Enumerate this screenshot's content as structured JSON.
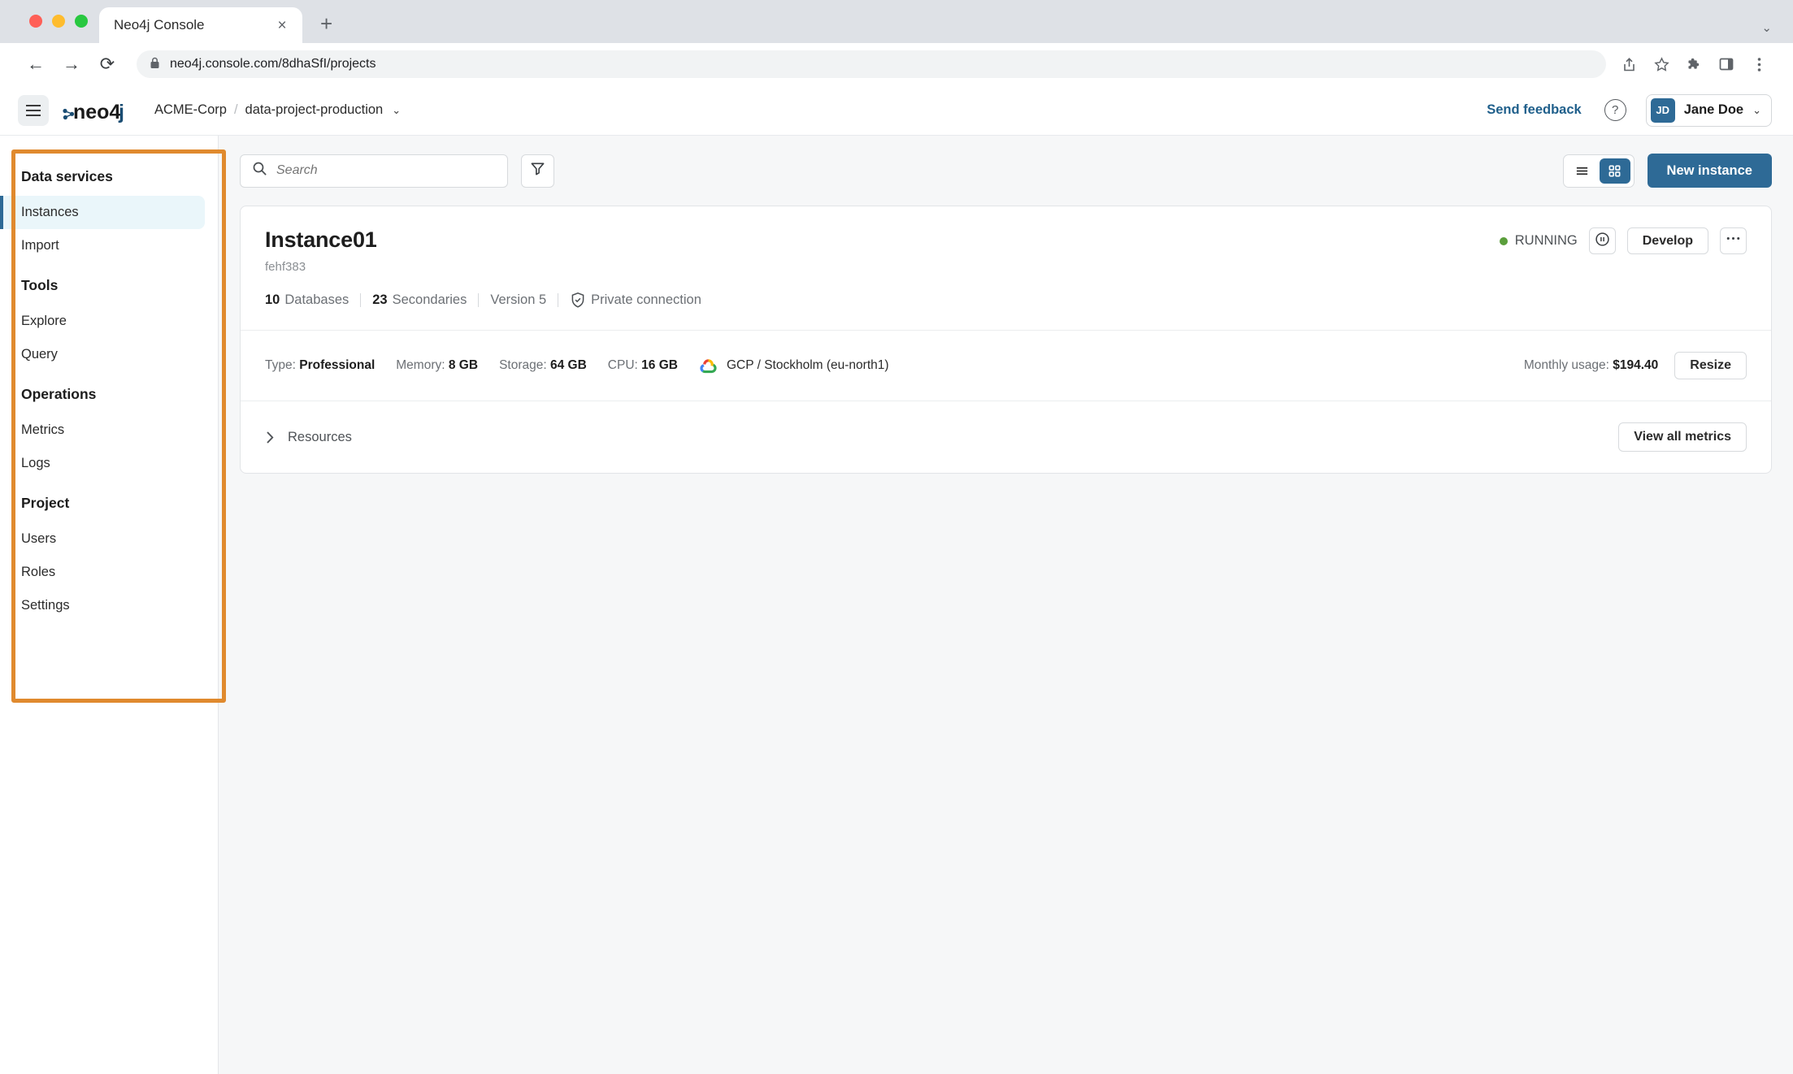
{
  "browser": {
    "tab_title": "Neo4j Console",
    "close_label": "×",
    "newtab_label": "+",
    "back_label": "←",
    "forward_label": "→",
    "reload_label": "⟳",
    "url": "neo4j.console.com/8dhaSfI/projects",
    "lock_icon": "lock-icon",
    "window_chevron": "⌄"
  },
  "appbar": {
    "menu_icon": "hamburger-icon",
    "logo_text": "neo4j",
    "breadcrumb": {
      "org": "ACME-Corp",
      "separator": "/",
      "project": "data-project-production",
      "caret": "⌄"
    },
    "send_feedback": "Send feedback",
    "help_label": "?",
    "user": {
      "initials": "JD",
      "name": "Jane Doe",
      "caret": "⌄"
    }
  },
  "sidebar": {
    "sections": [
      {
        "title": "Data services",
        "items": [
          {
            "label": "Instances",
            "active": true
          },
          {
            "label": "Import",
            "active": false
          }
        ]
      },
      {
        "title": "Tools",
        "items": [
          {
            "label": "Explore",
            "active": false
          },
          {
            "label": "Query",
            "active": false
          }
        ]
      },
      {
        "title": "Operations",
        "items": [
          {
            "label": "Metrics",
            "active": false
          },
          {
            "label": "Logs",
            "active": false
          }
        ]
      },
      {
        "title": "Project",
        "items": [
          {
            "label": "Users",
            "active": false
          },
          {
            "label": "Roles",
            "active": false
          },
          {
            "label": "Settings",
            "active": false
          }
        ]
      }
    ],
    "highlight_color": "#e08a2e",
    "active_bg": "#eaf6fa",
    "active_bar": "#2e6a96"
  },
  "toolbar": {
    "search_placeholder": "Search",
    "search_value": "",
    "search_icon": "search-icon",
    "filter_icon": "filter-icon",
    "view_list_icon": "list-view-icon",
    "view_grid_icon": "grid-view-icon",
    "view_selected": "grid",
    "new_instance_label": "New instance"
  },
  "instance": {
    "name": "Instance01",
    "id": "fehf383",
    "meta": [
      {
        "value": "10",
        "label": "Databases"
      },
      {
        "value": "23",
        "label": "Secondaries"
      },
      {
        "value": "",
        "label": "Version 5"
      }
    ],
    "connection": {
      "icon": "shield-check-icon",
      "label": "Private connection"
    },
    "status": {
      "label": "RUNNING",
      "color": "#5a9e3b"
    },
    "pause_icon": "pause-circle-icon",
    "develop_label": "Develop",
    "more_label": "•••",
    "specs": [
      {
        "label": "Type:",
        "value": "Professional"
      },
      {
        "label": "Memory:",
        "value": "8 GB"
      },
      {
        "label": "Storage:",
        "value": "64 GB"
      },
      {
        "label": "CPU:",
        "value": "16 GB"
      }
    ],
    "cloud": {
      "icon": "google-cloud-icon",
      "label": "GCP / Stockholm (eu-north1)"
    },
    "usage_label": "Monthly usage:",
    "usage_value": "$194.40",
    "resize_label": "Resize",
    "resources_label": "Resources",
    "resources_caret": "›",
    "view_metrics_label": "View all metrics"
  },
  "theme": {
    "accent": "#2e6a96",
    "link": "#1f5f8b",
    "page_bg": "#f6f7f8"
  }
}
